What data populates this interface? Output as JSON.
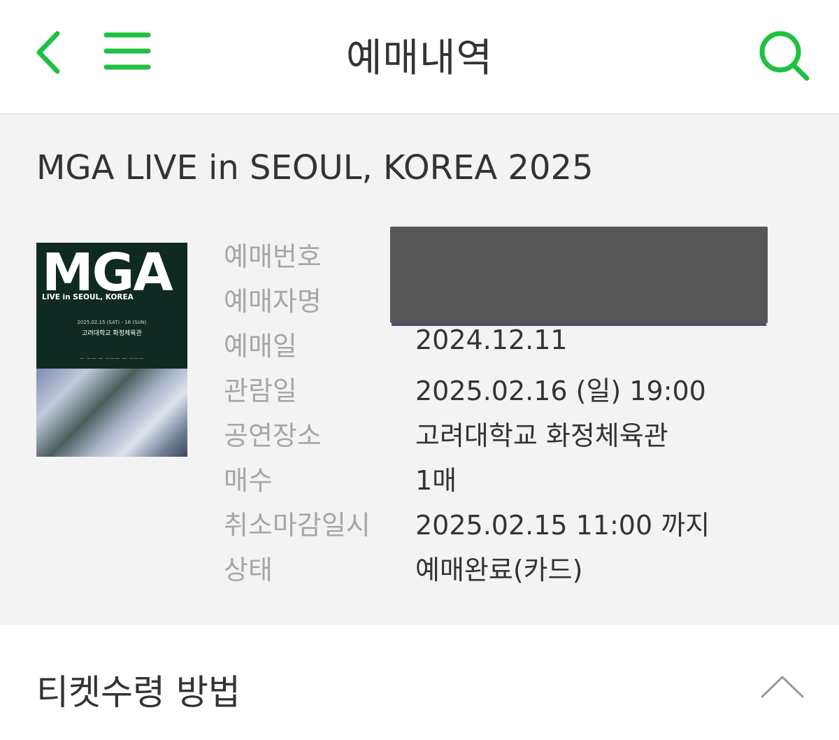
{
  "header": {
    "title": "예매내역",
    "accent_color": "#1ec142",
    "back_icon": "chevron-left-icon",
    "menu_icon": "hamburger-menu-icon",
    "search_icon": "search-icon"
  },
  "event": {
    "title": "MGA LIVE in SEOUL, KOREA 2025"
  },
  "poster": {
    "logo": "MGA",
    "subtitle": "LIVE in SEOUL, KOREA",
    "date_line": "2025.02.15 (SAT) - 16 (SUN)",
    "venue_line": "고려대학교 화정체육관",
    "sponsors": "— —— — ——— — ———"
  },
  "details": {
    "rows": [
      {
        "label": "예매번호",
        "value": ""
      },
      {
        "label": "예매자명",
        "value": ""
      },
      {
        "label": "예매일",
        "value": "2024.12.11"
      },
      {
        "label": "관람일",
        "value": "2025.02.16 (일) 19:00"
      },
      {
        "label": "공연장소",
        "value": "고려대학교 화정체육관"
      },
      {
        "label": "매수",
        "value": "1매"
      },
      {
        "label": "취소마감일시",
        "value": "2025.02.15 11:00 까지"
      },
      {
        "label": "상태",
        "value": "예매완료(카드)"
      }
    ]
  },
  "receipt": {
    "title": "티켓수령 방법",
    "toggle_icon": "chevron-up-icon"
  }
}
